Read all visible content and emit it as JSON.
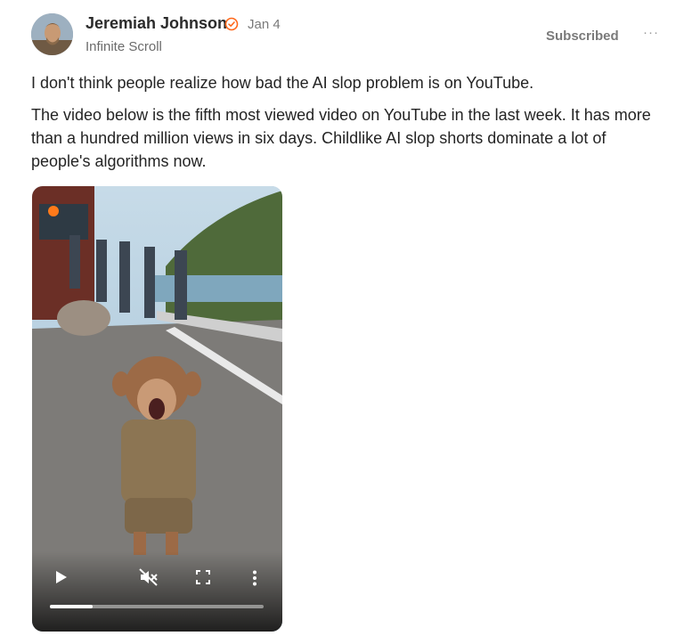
{
  "author": {
    "name": "Jeremiah Johnson",
    "date": "Jan 4",
    "publication": "Infinite Scroll",
    "verified_icon": "verified-badge-icon"
  },
  "actions": {
    "subscribed_label": "Subscribed",
    "more_label": "···"
  },
  "post": {
    "paragraphs": [
      "I don't think people realize how bad the AI slop problem is on YouTube.",
      "The video below is the fifth most viewed video on YouTube in the last week. It has more than a hundred million views in six days. Childlike AI slop shorts dominate a lot of people's algorithms now."
    ]
  },
  "video": {
    "progress": 0.2,
    "icons": [
      "play-icon",
      "mute-icon",
      "fullscreen-icon",
      "more-vertical-icon"
    ]
  },
  "colors": {
    "accent": "#ff6719",
    "text": "#242424",
    "muted": "#7a7a7a"
  }
}
